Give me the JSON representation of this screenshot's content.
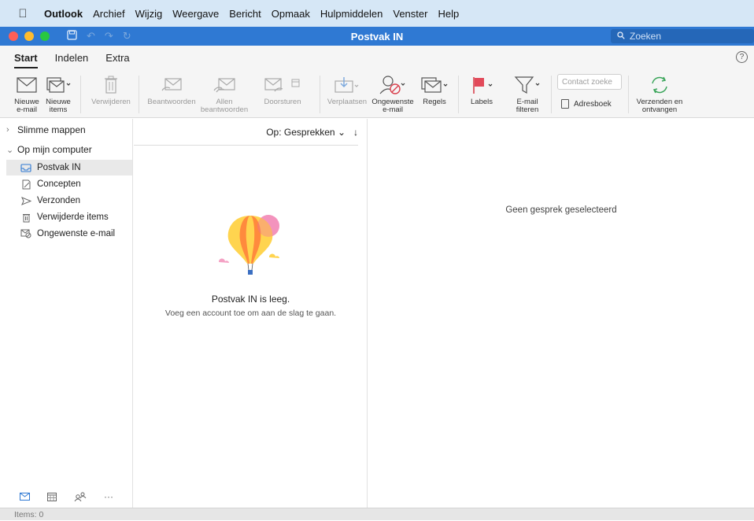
{
  "menubar": {
    "items": [
      "Outlook",
      "Archief",
      "Wijzig",
      "Weergave",
      "Bericht",
      "Opmaak",
      "Hulpmiddelen",
      "Venster",
      "Help"
    ]
  },
  "window": {
    "title": "Postvak IN",
    "search_placeholder": "Zoeken"
  },
  "ribbon": {
    "tabs": [
      "Start",
      "Indelen",
      "Extra"
    ],
    "active_tab": "Start",
    "buttons": {
      "new_email": "Nieuwe e-mail",
      "new_items": "Nieuwe items",
      "delete": "Verwijderen",
      "reply": "Beantwoorden",
      "reply_all": "Allen beantwoorden",
      "forward": "Doorsturen",
      "move": "Verplaatsen",
      "junk": "Ongewenste e-mail",
      "rules": "Regels",
      "labels": "Labels",
      "filter": "E-mail filteren",
      "contact_search_placeholder": "Contact zoeke",
      "address_book": "Adresboek",
      "send_receive": "Verzenden en ontvangen"
    }
  },
  "sidebar": {
    "groups": [
      {
        "label": "Slimme mappen",
        "expanded": false
      },
      {
        "label": "Op mijn computer",
        "expanded": true
      }
    ],
    "folders": [
      {
        "label": "Postvak IN",
        "icon": "inbox-icon",
        "selected": true
      },
      {
        "label": "Concepten",
        "icon": "drafts-icon",
        "selected": false
      },
      {
        "label": "Verzonden",
        "icon": "sent-icon",
        "selected": false
      },
      {
        "label": "Verwijderde items",
        "icon": "trash-icon",
        "selected": false
      },
      {
        "label": "Ongewenste e-mail",
        "icon": "junk-icon",
        "selected": false
      }
    ]
  },
  "message_list": {
    "sort_label": "Op: Gesprekken",
    "empty_title": "Postvak IN is leeg.",
    "empty_subtitle": "Voeg een account toe om aan de slag te gaan."
  },
  "reading_pane": {
    "no_selection": "Geen gesprek geselecteerd"
  },
  "statusbar": {
    "items": "Items: 0"
  },
  "colors": {
    "titlebar": "#2f79d3",
    "menubar": "#d6e7f6",
    "send_receive_green": "#3aa55a",
    "label_flag_red": "#e24a5a"
  }
}
